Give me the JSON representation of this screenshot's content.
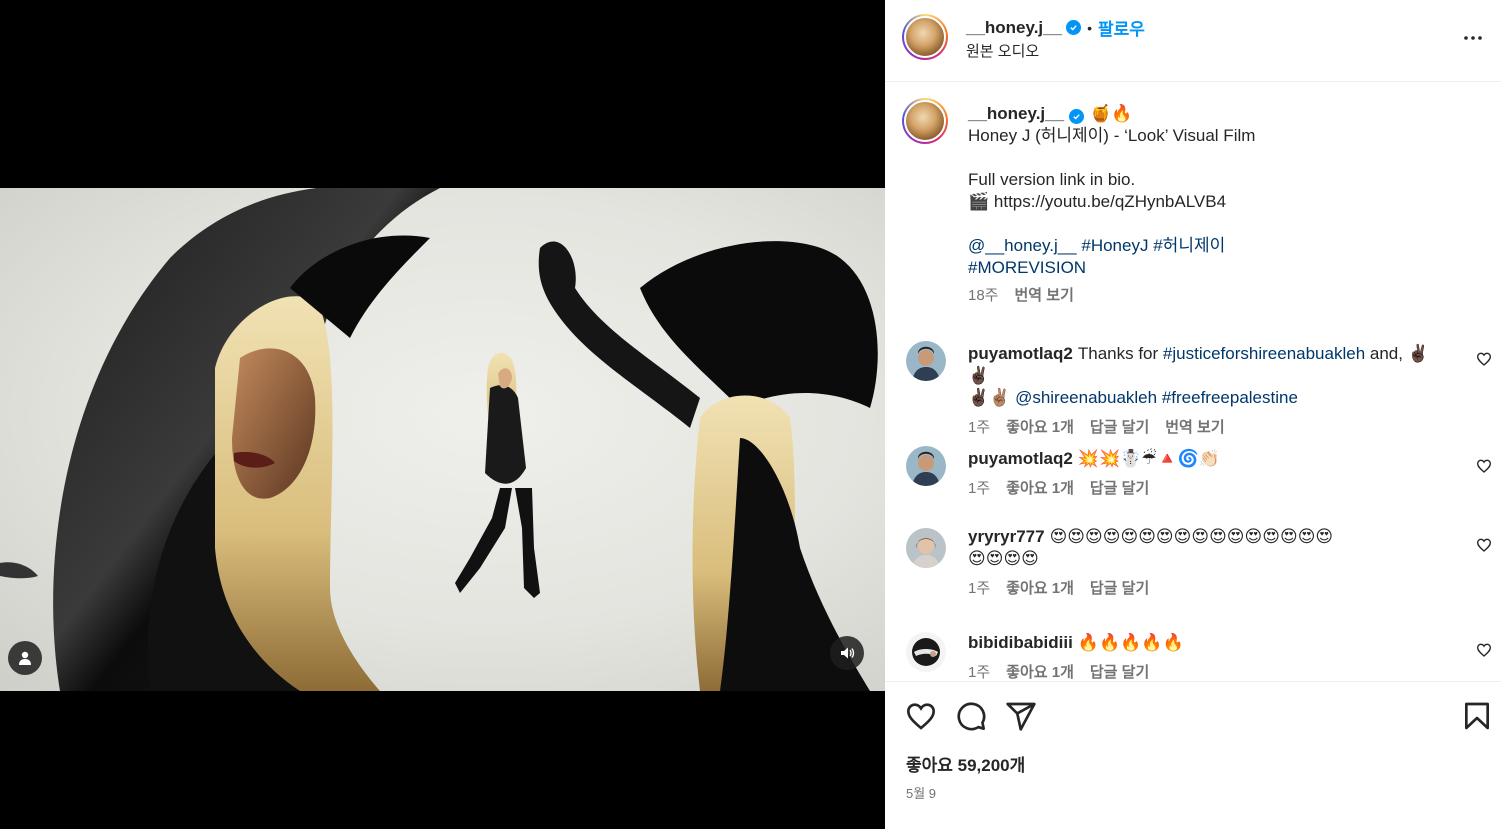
{
  "post": {
    "username": "__honey.j__",
    "separator": "•",
    "follow_label": "팔로우",
    "audio_label": "원본 오디오",
    "more_icon": "more-horizontal-icon"
  },
  "caption": {
    "username": "__honey.j__",
    "emoji": "🍯🔥",
    "line1": "Honey J (허니제이) - ‘Look’ Visual Film",
    "line2": "Full version link in bio.",
    "line3": "🎬 https://youtu.be/qZHynbALVB4",
    "mention": "@__honey.j__",
    "tag1": "#HoneyJ",
    "tag2": "#허니제이",
    "tag3": "#MOREVISION",
    "time": "18주",
    "translate": "번역 보기"
  },
  "comments": [
    {
      "username": "puyamotlaq2",
      "text_plain": "Thanks for ",
      "link1": "#justiceforshireenabuakleh",
      "text_mid": " and, ✌🏿✌🏿",
      "text2": "✌🏿✌🏽 ",
      "link2": "@shireenabuakleh",
      "link3": "#freefreepalestine",
      "time": "1주",
      "likes": "좋아요 1개",
      "reply": "답글 달기",
      "translate": "번역 보기"
    },
    {
      "username": "puyamotlaq2",
      "text": "💥💥☃️☔🔺🌀👏🏻",
      "time": "1주",
      "likes": "좋아요 1개",
      "reply": "답글 달기"
    },
    {
      "username": "yryryr777",
      "text": "😍😍😍😍😍😍😍😍😍😍😍😍😍😍😍😍",
      "text2": "😍😍😍😍",
      "time": "1주",
      "likes": "좋아요 1개",
      "reply": "답글 달기"
    },
    {
      "username": "bibidibabidiii",
      "text": "🔥🔥🔥🔥🔥",
      "time": "1주",
      "likes": "좋아요 1개",
      "reply": "답글 달기"
    }
  ],
  "footer": {
    "likes": "좋아요 59,200개",
    "date": "5월 9"
  },
  "colors": {
    "accent": "#0095f6",
    "link": "#00376b",
    "muted": "#737373"
  }
}
